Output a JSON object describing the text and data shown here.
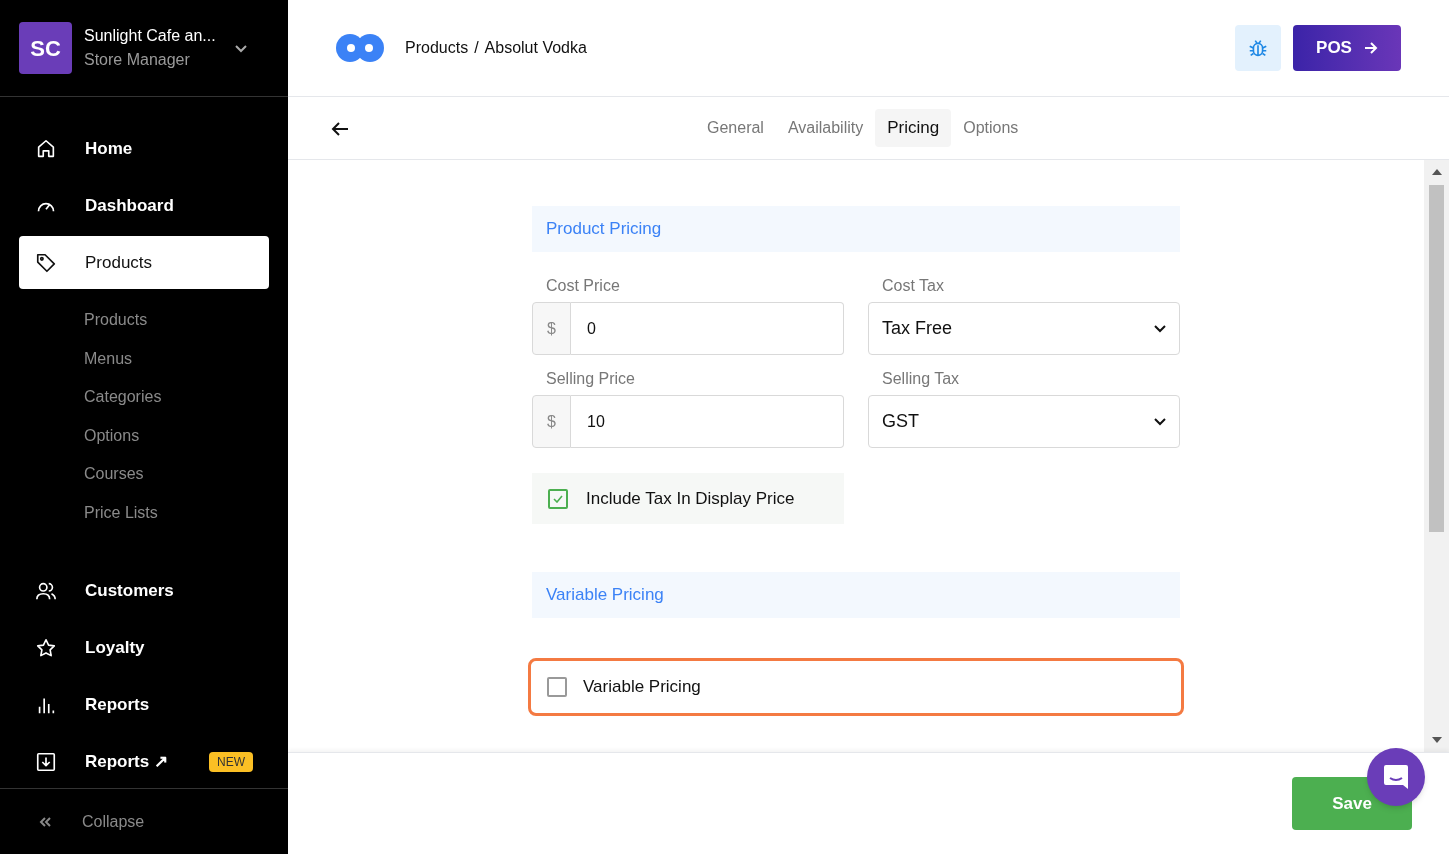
{
  "account": {
    "initials": "SC",
    "name": "Sunlight Cafe an...",
    "role": "Store Manager"
  },
  "nav": [
    {
      "label": "Home",
      "selected": false
    },
    {
      "label": "Dashboard",
      "selected": false
    },
    {
      "label": "Products",
      "selected": true,
      "children": [
        {
          "label": "Products"
        },
        {
          "label": "Menus"
        },
        {
          "label": "Categories"
        },
        {
          "label": "Options"
        },
        {
          "label": "Courses"
        },
        {
          "label": "Price Lists"
        }
      ]
    },
    {
      "label": "Customers",
      "selected": false
    },
    {
      "label": "Loyalty",
      "selected": false
    },
    {
      "label": "Reports",
      "selected": false
    },
    {
      "label": "Reports ↗",
      "selected": false,
      "badge": "NEW"
    }
  ],
  "collapse": "Collapse",
  "breadcrumb": [
    "Products",
    "Absolut Vodka"
  ],
  "breadcrumb_separator": "/",
  "pos_button": "POS",
  "tabs": [
    {
      "label": "General",
      "selected": false
    },
    {
      "label": "Availability",
      "selected": false
    },
    {
      "label": "Pricing",
      "selected": true
    },
    {
      "label": "Options",
      "selected": false
    }
  ],
  "sections": [
    {
      "title": "Product Pricing",
      "fields": [
        {
          "kind": "money",
          "label": "Cost Price",
          "prefix": "$",
          "value": "0"
        },
        {
          "kind": "select",
          "label": "Cost Tax",
          "value": "Tax Free"
        },
        {
          "kind": "money",
          "label": "Selling Price",
          "prefix": "$",
          "value": "10"
        },
        {
          "kind": "select",
          "label": "Selling Tax",
          "value": "GST"
        },
        {
          "kind": "checkbox",
          "label": "Include Tax In Display Price",
          "checked": true,
          "highlighted": false
        }
      ]
    },
    {
      "title": "Variable Pricing",
      "fields": [
        {
          "kind": "checkbox",
          "label": "Variable Pricing",
          "checked": false,
          "highlighted": true
        }
      ]
    }
  ],
  "save_button": "Save"
}
